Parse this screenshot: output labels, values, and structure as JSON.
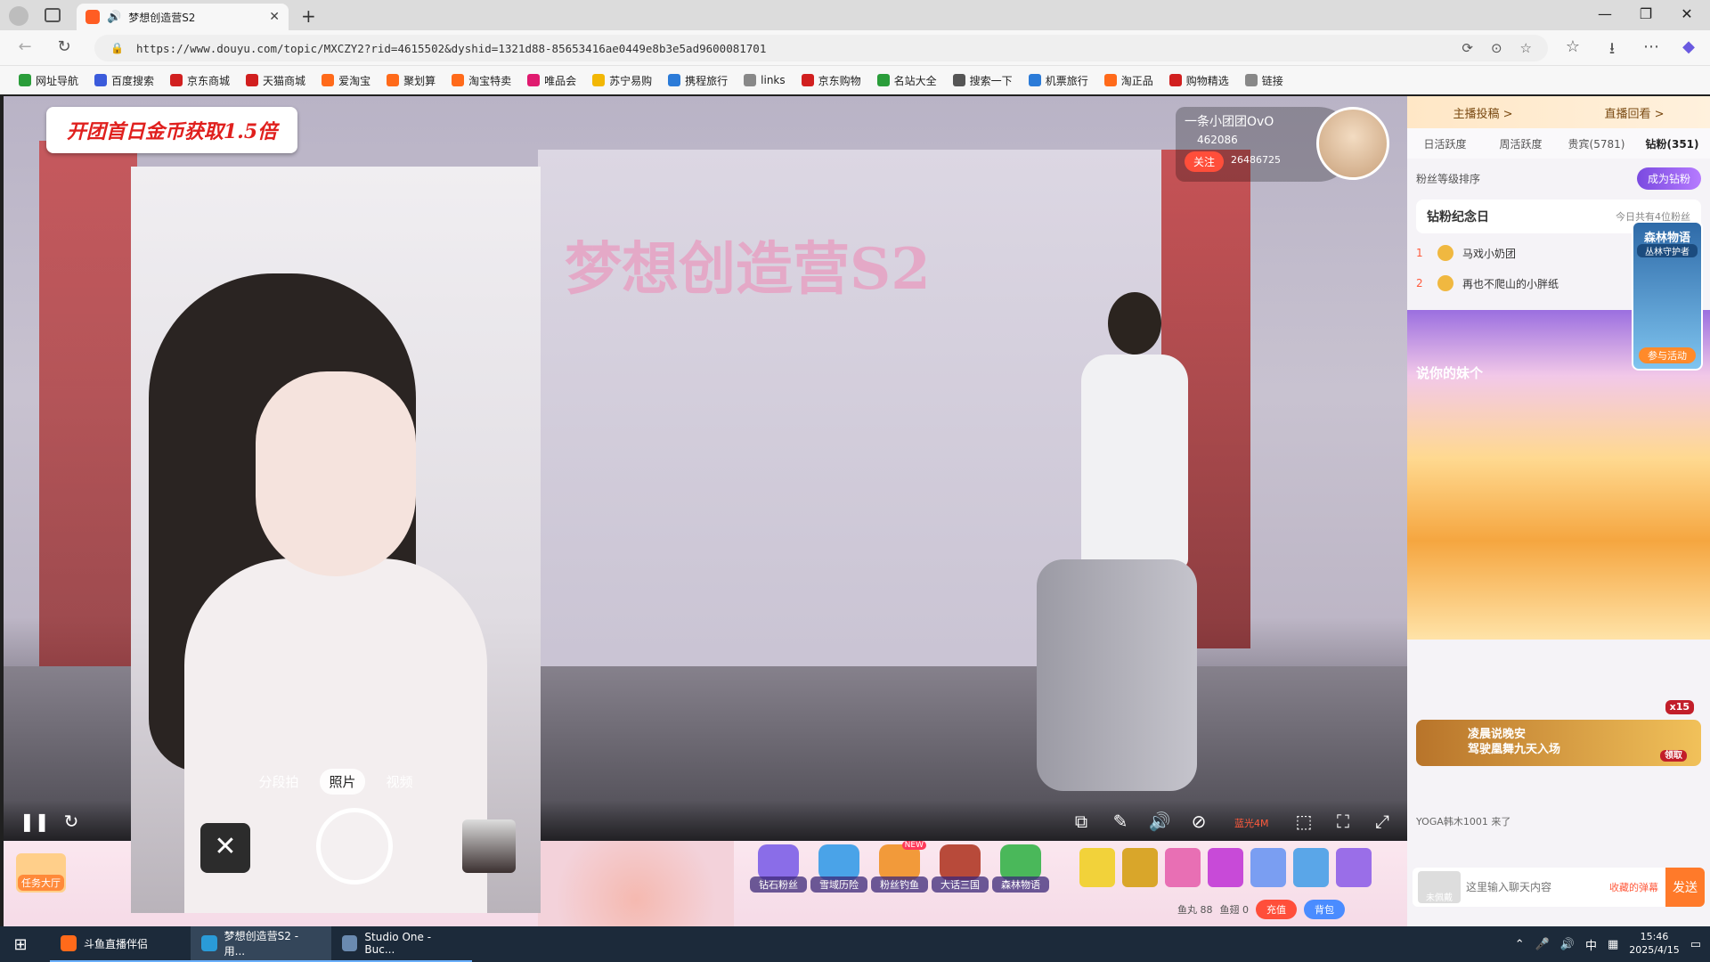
{
  "browser": {
    "tab_title": "梦想创造营S2",
    "url": "https://www.douyu.com/topic/MXCZY2?rid=4615502&dyshid=1321d88-85653416ae0449e8b3e5ad9600081701",
    "bookmarks": [
      {
        "label": "网址导航",
        "color": "#2a9d3a"
      },
      {
        "label": "百度搜索",
        "color": "#3b5bdb"
      },
      {
        "label": "京东商城",
        "color": "#d11f1f"
      },
      {
        "label": "天猫商城",
        "color": "#d11f1f"
      },
      {
        "label": "爱淘宝",
        "color": "#ff6a1a"
      },
      {
        "label": "聚划算",
        "color": "#ff6a1a"
      },
      {
        "label": "淘宝特卖",
        "color": "#ff6a1a"
      },
      {
        "label": "唯品会",
        "color": "#e01a6f"
      },
      {
        "label": "苏宁易购",
        "color": "#f2b705"
      },
      {
        "label": "携程旅行",
        "color": "#2b7bd8"
      },
      {
        "label": "links",
        "color": "#888888"
      },
      {
        "label": "京东购物",
        "color": "#d11f1f"
      },
      {
        "label": "名站大全",
        "color": "#2a9d3a"
      },
      {
        "label": "搜索一下",
        "color": "#555555"
      },
      {
        "label": "机票旅行",
        "color": "#2b7bd8"
      },
      {
        "label": "淘正品",
        "color": "#ff6a1a"
      },
      {
        "label": "购物精选",
        "color": "#d11f1f"
      },
      {
        "label": "链接",
        "color": "#888888"
      }
    ]
  },
  "video": {
    "promo_text": "开团首日金币获取1.5倍",
    "watermark": "梦想创造营S2",
    "streamer_name": "一条小团团OvO",
    "streamer_fans": "462086",
    "follow_label": "关注",
    "follow_count": "26486725",
    "quality_label": "蓝光4M"
  },
  "camera": {
    "modes": [
      "分段拍",
      "照片",
      "视频"
    ],
    "active_mode": "照片",
    "close_symbol": "✕"
  },
  "giftbar": {
    "task_label": "任务大厅",
    "gifts": [
      {
        "label": "钻石粉丝",
        "color": "#8a6de8"
      },
      {
        "label": "雪域历险",
        "color": "#4aa3e8"
      },
      {
        "label": "粉丝钓鱼",
        "color": "#f29a3a",
        "badge": "NEW"
      },
      {
        "label": "大话三国",
        "color": "#b84a3a"
      },
      {
        "label": "森林物语",
        "color": "#4ab85a"
      }
    ],
    "bag_colors": [
      "#f2d23a",
      "#d9a62a",
      "#e86fb4",
      "#c84ad8",
      "#7a9ef2",
      "#5aa6e8",
      "#9a6ee8"
    ],
    "yuwan": "鱼丸 88",
    "yuchi": "鱼翅 0",
    "pay_label": "充值",
    "pack_label": "背包"
  },
  "sidebar": {
    "top": [
      "主播投稿 >",
      "直播回看 >"
    ],
    "tabs": [
      "日活跃度",
      "周活跃度",
      "贵宾(5781)",
      "钻粉(351)"
    ],
    "active_tab": "钻粉(351)",
    "fan_level_label": "粉丝等级排序",
    "become_btn": "成为钻粉",
    "anniv_title": "钻粉纪念日",
    "anniv_sub": "今日共有4位粉丝",
    "rank": [
      {
        "n": "1",
        "name": "马戏小奶团"
      },
      {
        "n": "2",
        "name": "再也不爬山的小胖纸"
      }
    ],
    "say_text": "说你的妹个",
    "event_title": "森林物语",
    "event_sub": "丛林守护者",
    "event_btn": "参与活动",
    "notice_line1": "凌晨说晚安",
    "notice_line2": "驾驶凰舞九天入场",
    "notice_badge": "x15",
    "notice_claim": "领取",
    "join_msg": "YOGA韩木1001 来了",
    "chat_placeholder": "这里输入聊天内容",
    "color_barrage": "收藏的弹幕",
    "send_label": "发送",
    "level_label": "未佩戴"
  },
  "taskbar": {
    "items": [
      {
        "label": "斗鱼直播伴侣",
        "color": "#ff6a1a"
      },
      {
        "label": "梦想创造营S2 - 用...",
        "color": "#2a9bd8"
      },
      {
        "label": "Studio One - Buc...",
        "color": "#6a8ab0"
      }
    ],
    "ime": "中",
    "time": "15:46",
    "date": "2025/4/15"
  }
}
